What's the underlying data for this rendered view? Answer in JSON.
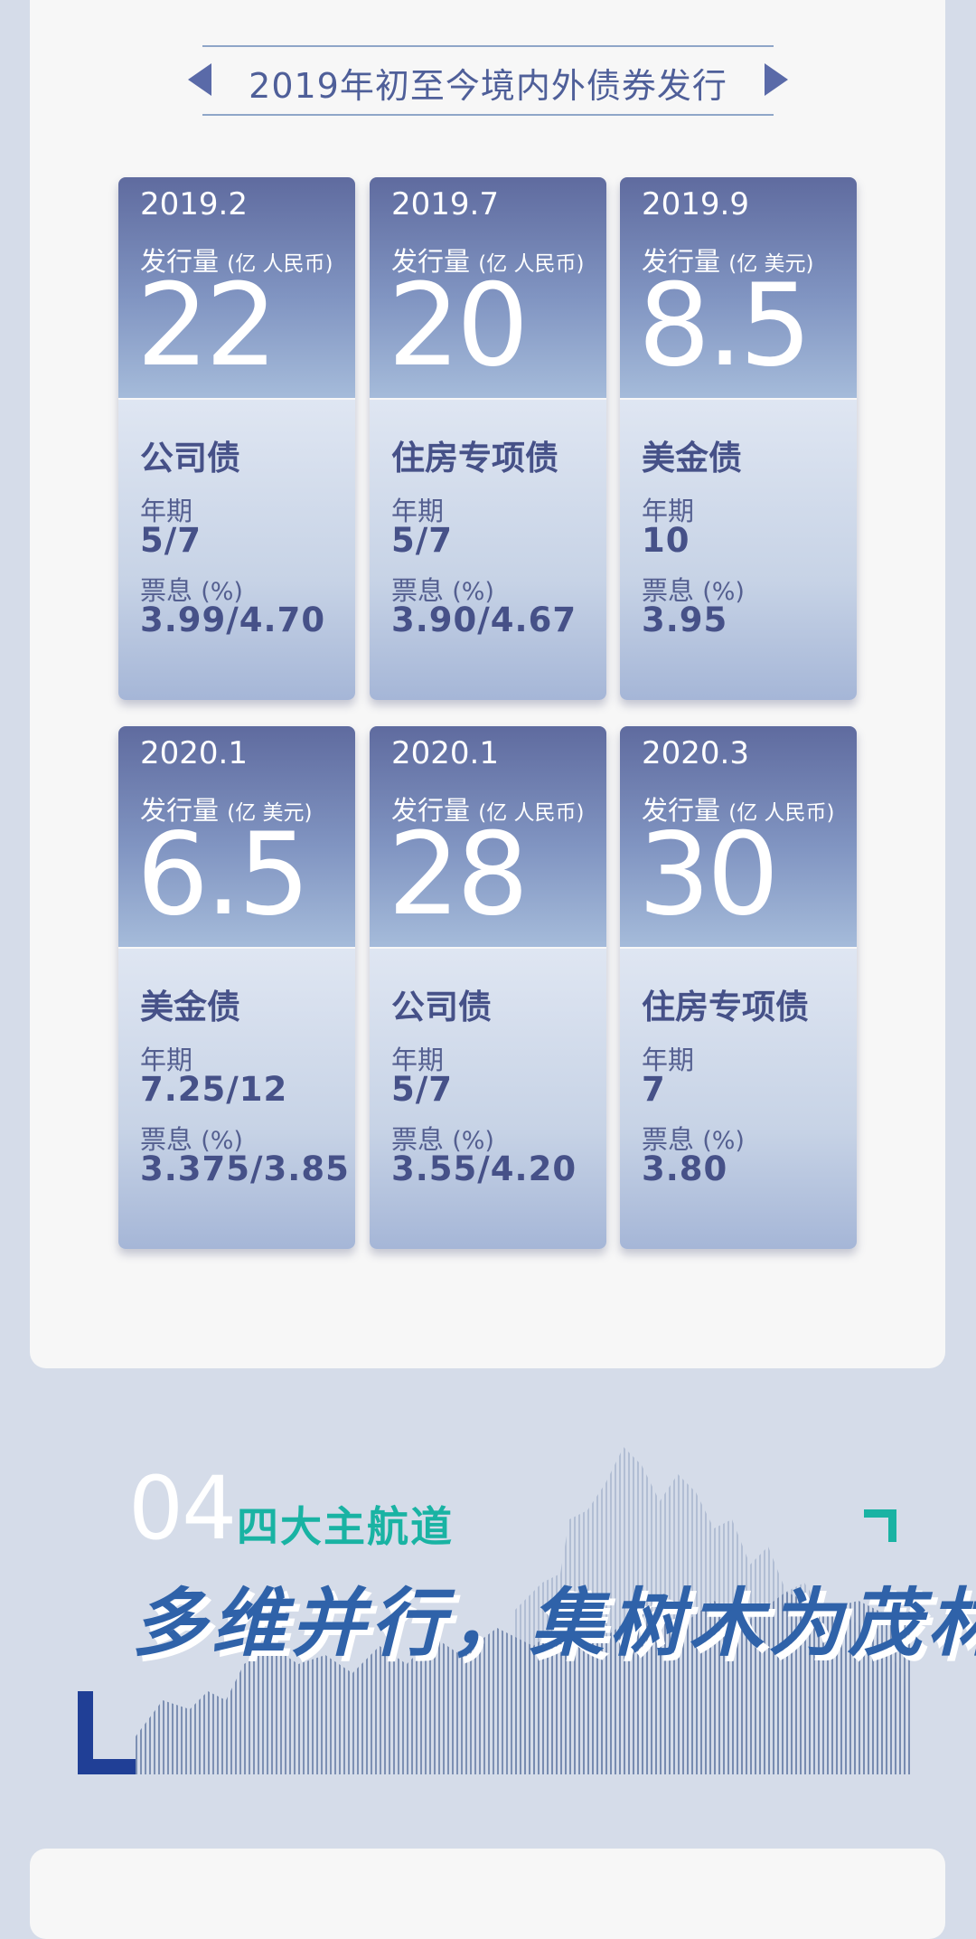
{
  "banner": {
    "title": "2019年初至今境内外债券发行"
  },
  "labels": {
    "tenor": "年期",
    "coupon": "票息",
    "coupon_unit": "(%)",
    "volume": "发行量"
  },
  "cards": [
    {
      "date": "2019.2",
      "unit": "(亿 人民币)",
      "amount": "22",
      "type": "公司债",
      "tenor": "5/7",
      "coupon": "3.99/4.70"
    },
    {
      "date": "2019.7",
      "unit": "(亿 人民币)",
      "amount": "20",
      "type": "住房专项债",
      "tenor": "5/7",
      "coupon": "3.90/4.67"
    },
    {
      "date": "2019.9",
      "unit": "(亿 美元)",
      "amount": "8.5",
      "type": "美金债",
      "tenor": "10",
      "coupon": "3.95"
    },
    {
      "date": "2020.1",
      "unit": "(亿 美元)",
      "amount": "6.5",
      "type": "美金债",
      "tenor": "7.25/12",
      "coupon": "3.375/3.85"
    },
    {
      "date": "2020.1",
      "unit": "(亿 人民币)",
      "amount": "28",
      "type": "公司债",
      "tenor": "5/7",
      "coupon": "3.55/4.20"
    },
    {
      "date": "2020.3",
      "unit": "(亿 人民币)",
      "amount": "30",
      "type": "住房专项债",
      "tenor": "7",
      "coupon": "3.80"
    }
  ],
  "section": {
    "number": "04",
    "subtitle": "四大主航道",
    "title": "多维并行，集树木为茂林"
  },
  "colors": {
    "accent": "#19b3a3",
    "navy": "#203f96",
    "title_blue": "#2f62a9",
    "card_text": "#465188"
  }
}
